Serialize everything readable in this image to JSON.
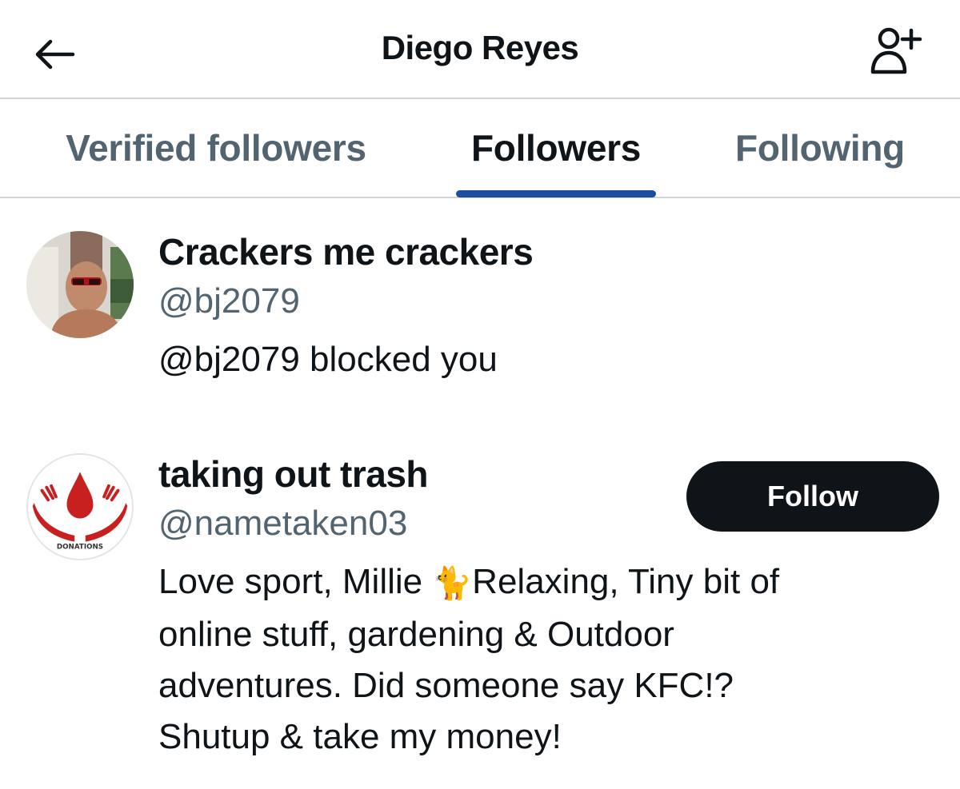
{
  "header": {
    "back_icon": "back-arrow-icon",
    "title": "Diego Reyes",
    "add_user_icon": "add-user-icon"
  },
  "tabs": [
    {
      "label": "Verified followers",
      "active": false
    },
    {
      "label": "Followers",
      "active": true
    },
    {
      "label": "Following",
      "active": false
    }
  ],
  "users": [
    {
      "display_name": "Crackers me crackers",
      "handle": "@bj2079",
      "status": "@bj2079 blocked you"
    },
    {
      "display_name": "taking out trash",
      "handle": "@nametaken03",
      "bio_parts": {
        "pre_emoji": "Love sport, Millie ",
        "emoji": "🐈",
        "line1_rest": "Relaxing, Tiny bit of",
        "line2": "online stuff, gardening & Outdoor",
        "line3": "adventures. Did someone say KFC!?",
        "line4": "Shutup & take my money!"
      },
      "avatar_text": "DONATIONS",
      "follow_label": "Follow"
    }
  ],
  "colors": {
    "text_primary": "#0f1419",
    "text_secondary": "#536471",
    "tab_indicator": "#1d4fa0",
    "follow_bg": "#0f1419",
    "donation_red": "#c8201f"
  }
}
